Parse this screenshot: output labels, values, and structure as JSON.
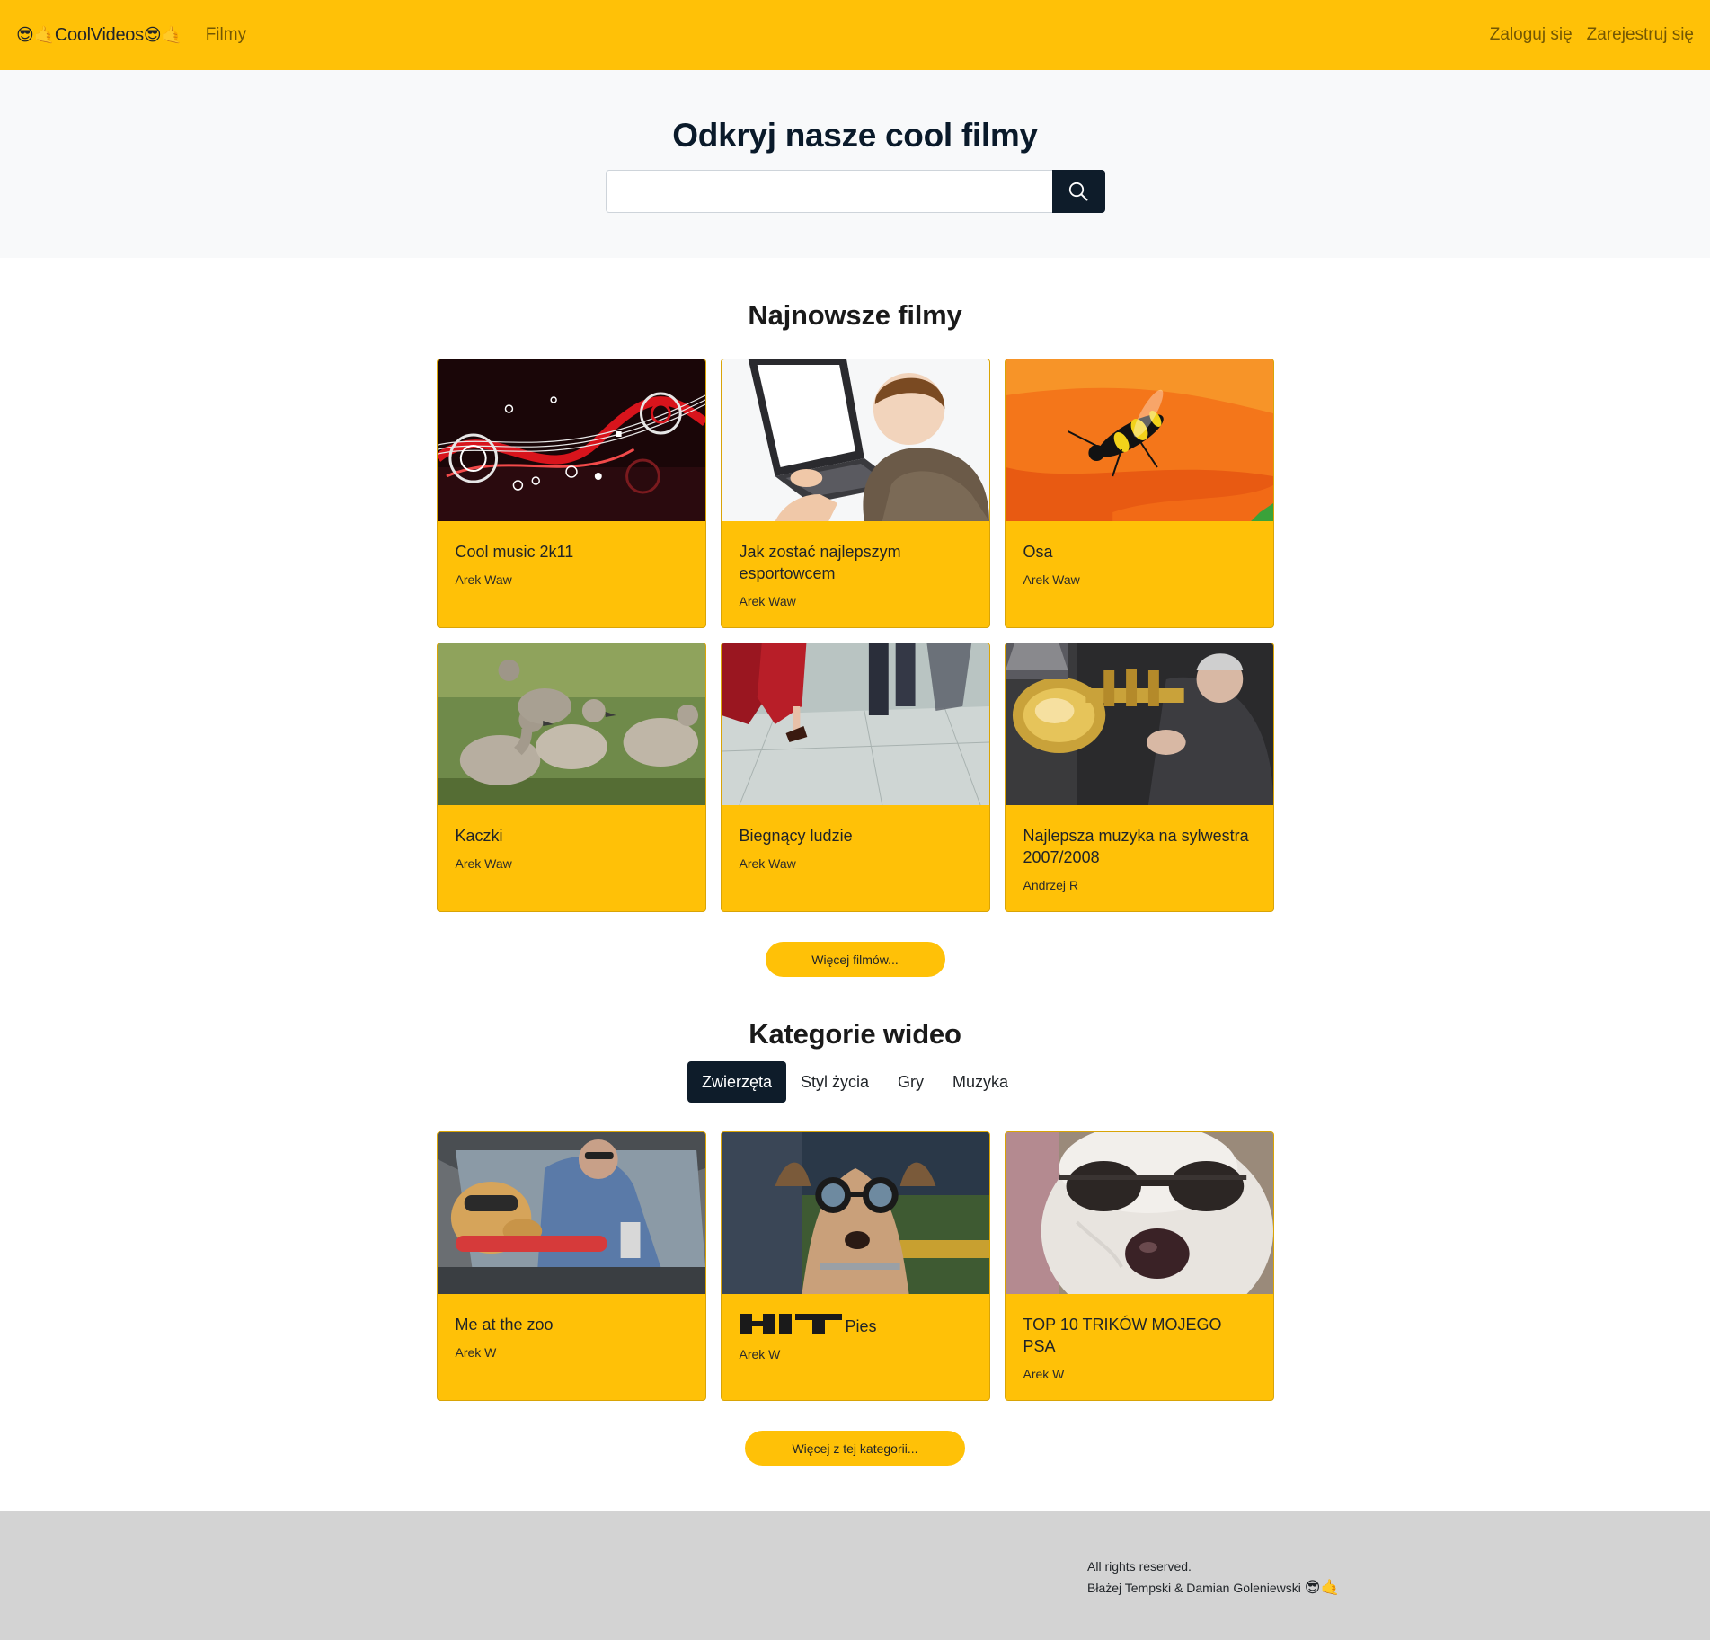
{
  "navbar": {
    "brand_left_emoji": "😎🤙",
    "brand_name": "CoolVideos",
    "brand_right_emoji": "😎🤙",
    "films_link": "Filmy",
    "login_link": "Zaloguj się",
    "register_link": "Zarejestruj się",
    "background_color": "#ffc107"
  },
  "hero": {
    "title": "Odkryj nasze cool filmy",
    "search_value": "",
    "search_icon": "search-icon"
  },
  "newest": {
    "title": "Najnowsze filmy",
    "cards": [
      {
        "title": "Cool music 2k11",
        "author": "Arek Waw",
        "thumb": "abstract-music-art"
      },
      {
        "title": "Jak zostać najlepszym esportowcem",
        "author": "Arek Waw",
        "thumb": "boy-with-laptop"
      },
      {
        "title": "Osa",
        "author": "Arek Waw",
        "thumb": "wasp-on-flower"
      },
      {
        "title": "Kaczki",
        "author": "Arek Waw",
        "thumb": "cygnets-on-grass"
      },
      {
        "title": "Biegnący ludzie",
        "author": "Arek Waw",
        "thumb": "people-walking"
      },
      {
        "title": "Najlepsza muzyka na sylwestra 2007/2008",
        "author": "Andrzej R",
        "thumb": "brass-band"
      }
    ],
    "more_button": "Więcej filmów..."
  },
  "categories": {
    "title": "Kategorie wideo",
    "tabs": [
      "Zwierzęta",
      "Styl życia",
      "Gry",
      "Muzyka"
    ],
    "active_tab": "Zwierzęta",
    "cards": [
      {
        "title": "Me at the zoo",
        "author": "Arek W",
        "thumb": "dog-in-car"
      },
      {
        "badge": "HIT",
        "title": "Pies",
        "author": "Arek W",
        "thumb": "dog-goggles"
      },
      {
        "title": "TOP 10 TRIKÓW MOJEGO PSA",
        "author": "Arek W",
        "thumb": "white-dog-sunglasses"
      }
    ],
    "more_button": "Więcej z tej kategorii..."
  },
  "footer": {
    "rights": "All rights reserved.",
    "authors": "Błażej Tempski & Damian Goleniewski",
    "emoji": "😎🤙"
  },
  "colors": {
    "accent": "#ffc107",
    "dark": "#0e1c2a",
    "footer_bg": "#d3d3d3",
    "hero_bg": "#f8f9fa"
  }
}
